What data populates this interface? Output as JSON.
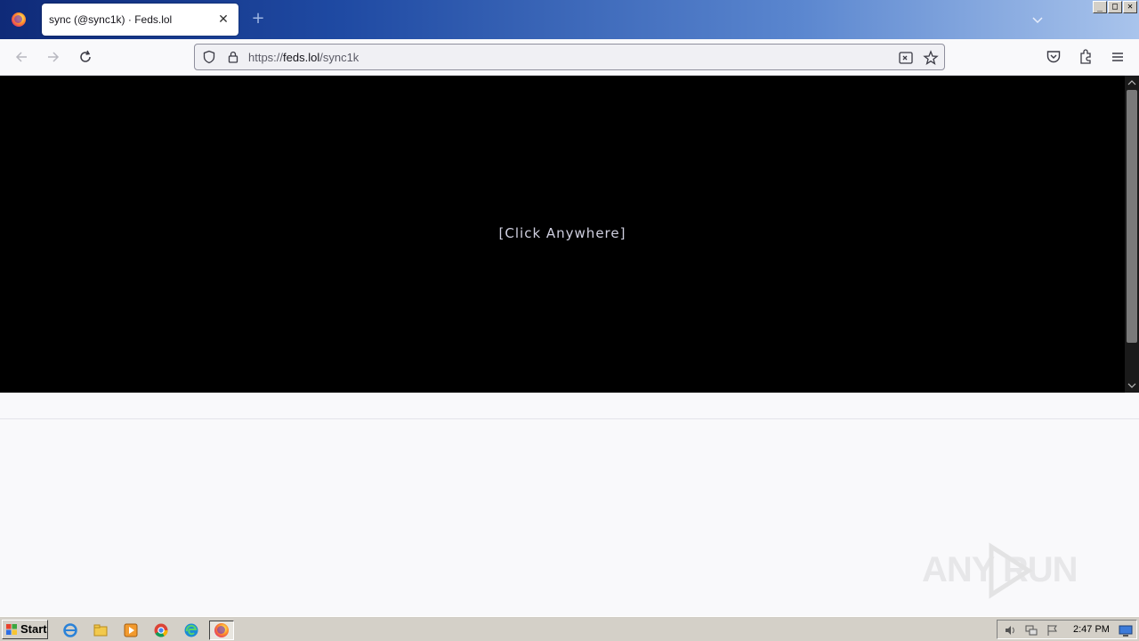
{
  "browser": {
    "tab": {
      "title": "sync (@sync1k) · Feds.lol",
      "close_glyph": "✕"
    },
    "new_tab_glyph": "+",
    "url": {
      "scheme": "https://",
      "domain": "feds.lol",
      "path": "/sync1k"
    },
    "window_controls": {
      "minimize": "_",
      "maximize": "□",
      "close": "✕"
    }
  },
  "page": {
    "center_text": "[Click Anywhere]",
    "background_color": "#000000"
  },
  "watermark": {
    "text": "ANY RUN"
  },
  "taskbar": {
    "start_label": "Start",
    "apps": [
      "internet-explorer-icon",
      "file-explorer-icon",
      "media-player-icon",
      "chrome-icon",
      "edge-icon",
      "firefox-icon"
    ],
    "clock": "2:47 PM"
  }
}
